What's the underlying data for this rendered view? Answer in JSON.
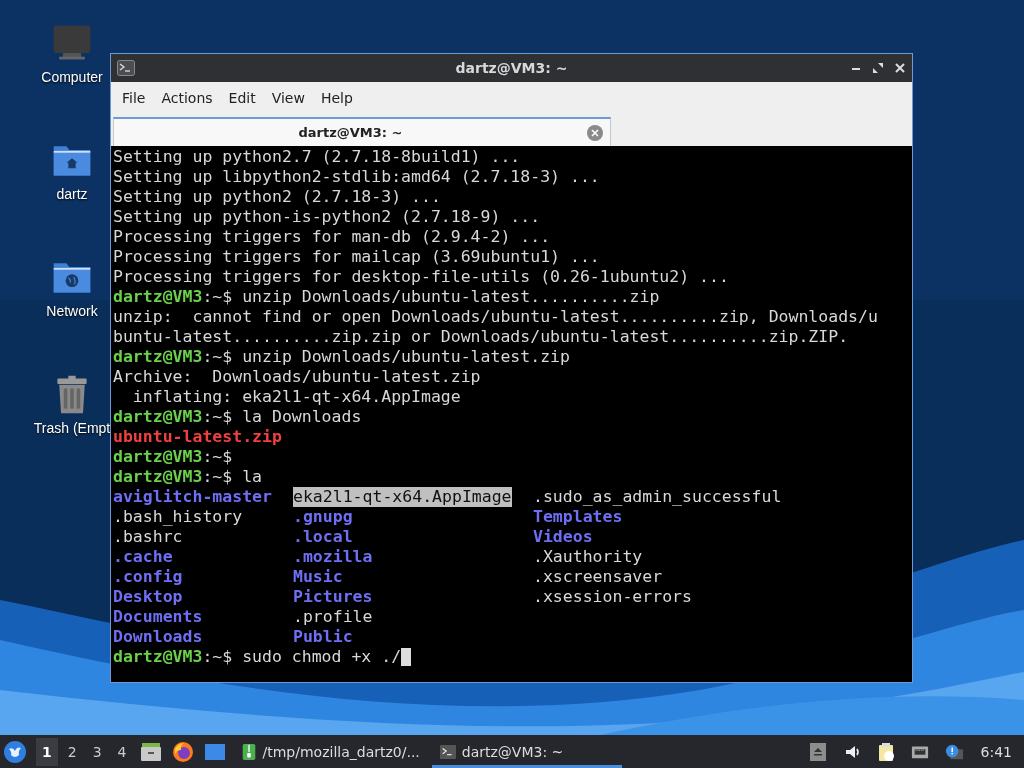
{
  "desktop_icons": [
    {
      "label": "Computer",
      "kind": "computer"
    },
    {
      "label": "dartz",
      "kind": "home"
    },
    {
      "label": "Network",
      "kind": "network"
    },
    {
      "label": "Trash (Empt",
      "kind": "trash"
    }
  ],
  "window": {
    "title": "dartz@VM3: ~",
    "menu": [
      "File",
      "Actions",
      "Edit",
      "View",
      "Help"
    ],
    "tabs": [
      {
        "label": "dartz@VM3: ~",
        "selected": true
      }
    ],
    "lines": [
      [
        {
          "text": "Setting up python2.7 (2.7.18-8build1) ...",
          "kind": "plain"
        }
      ],
      [
        {
          "text": "Setting up libpython2-stdlib:amd64 (2.7.18-3) ...",
          "kind": "plain"
        }
      ],
      [
        {
          "text": "Setting up python2 (2.7.18-3) ...",
          "kind": "plain"
        }
      ],
      [
        {
          "text": "Setting up python-is-python2 (2.7.18-9) ...",
          "kind": "plain"
        }
      ],
      [
        {
          "text": "Processing triggers for man-db (2.9.4-2) ...",
          "kind": "plain"
        }
      ],
      [
        {
          "text": "Processing triggers for mailcap (3.69ubuntu1) ...",
          "kind": "plain"
        }
      ],
      [
        {
          "text": "Processing triggers for desktop-file-utils (0.26-1ubuntu2) ...",
          "kind": "plain"
        }
      ],
      [
        {
          "text": "dartz@VM3",
          "kind": "user"
        },
        {
          "text": ":~$ unzip Downloads/ubuntu-latest..........zip",
          "kind": "plain"
        }
      ],
      [
        {
          "text": "unzip:  cannot find or open Downloads/ubuntu-latest..........zip, Downloads/u",
          "kind": "plain"
        }
      ],
      [
        {
          "text": "buntu-latest..........zip.zip or Downloads/ubuntu-latest..........zip.ZIP.",
          "kind": "plain"
        }
      ],
      [
        {
          "text": "dartz@VM3",
          "kind": "user"
        },
        {
          "text": ":~$ unzip Downloads/ubuntu-latest.zip",
          "kind": "plain"
        }
      ],
      [
        {
          "text": "Archive:  Downloads/ubuntu-latest.zip",
          "kind": "plain"
        }
      ],
      [
        {
          "text": "  inflating: eka2l1-qt-x64.AppImage",
          "kind": "plain"
        }
      ],
      [
        {
          "text": "dartz@VM3",
          "kind": "user"
        },
        {
          "text": ":~$ la Downloads",
          "kind": "plain"
        }
      ],
      [
        {
          "text": "ubuntu-latest.zip",
          "kind": "archive"
        }
      ],
      [
        {
          "text": "dartz@VM3",
          "kind": "user"
        },
        {
          "text": ":~$",
          "kind": "plain"
        }
      ],
      [
        {
          "text": "dartz@VM3",
          "kind": "user"
        },
        {
          "text": ":~$ la",
          "kind": "plain"
        }
      ],
      {
        "columns": [
          {
            "text": "aviglitch-master",
            "kind": "dir"
          },
          {
            "text": "eka2l1-qt-x64.AppImage",
            "kind": "exec"
          },
          {
            "text": ".sudo_as_admin_successful",
            "kind": "plain"
          }
        ]
      },
      {
        "columns": [
          {
            "text": ".bash_history",
            "kind": "plain"
          },
          {
            "text": ".gnupg",
            "kind": "dir"
          },
          {
            "text": "Templates",
            "kind": "dir"
          }
        ]
      },
      {
        "columns": [
          {
            "text": ".bashrc",
            "kind": "plain"
          },
          {
            "text": ".local",
            "kind": "dir"
          },
          {
            "text": "Videos",
            "kind": "dir"
          }
        ]
      },
      {
        "columns": [
          {
            "text": ".cache",
            "kind": "dir"
          },
          {
            "text": ".mozilla",
            "kind": "dir"
          },
          {
            "text": ".Xauthority",
            "kind": "plain"
          }
        ]
      },
      {
        "columns": [
          {
            "text": ".config",
            "kind": "dir"
          },
          {
            "text": "Music",
            "kind": "dir"
          },
          {
            "text": ".xscreensaver",
            "kind": "plain"
          }
        ]
      },
      {
        "columns": [
          {
            "text": "Desktop",
            "kind": "dir"
          },
          {
            "text": "Pictures",
            "kind": "dir"
          },
          {
            "text": ".xsession-errors",
            "kind": "plain"
          }
        ]
      },
      {
        "columns": [
          {
            "text": "Documents",
            "kind": "dir"
          },
          {
            "text": ".profile",
            "kind": "plain"
          }
        ]
      },
      {
        "columns": [
          {
            "text": "Downloads",
            "kind": "dir"
          },
          {
            "text": "Public",
            "kind": "dir"
          }
        ]
      },
      [
        {
          "text": "dartz@VM3",
          "kind": "user"
        },
        {
          "text": ":~$ sudo chmod +x ./",
          "kind": "plain"
        },
        {
          "kind": "cursor"
        }
      ]
    ]
  },
  "taskbar": {
    "workspaces": [
      {
        "label": "1",
        "selected": true
      },
      {
        "label": "2",
        "selected": false
      },
      {
        "label": "3",
        "selected": false
      },
      {
        "label": "4",
        "selected": false
      }
    ],
    "launchers": [
      {
        "kind": "files"
      },
      {
        "kind": "browser"
      },
      {
        "kind": "desktop"
      }
    ],
    "tasks": [
      {
        "label": "/tmp/mozilla_dartz0/...",
        "kind": "archive",
        "selected": false
      },
      {
        "label": "dartz@VM3: ~",
        "kind": "terminal",
        "selected": true
      }
    ],
    "tray": [
      {
        "kind": "eject"
      },
      {
        "kind": "volume"
      },
      {
        "kind": "clipboard"
      },
      {
        "kind": "network"
      },
      {
        "kind": "notification"
      }
    ],
    "clock": "6:41"
  }
}
